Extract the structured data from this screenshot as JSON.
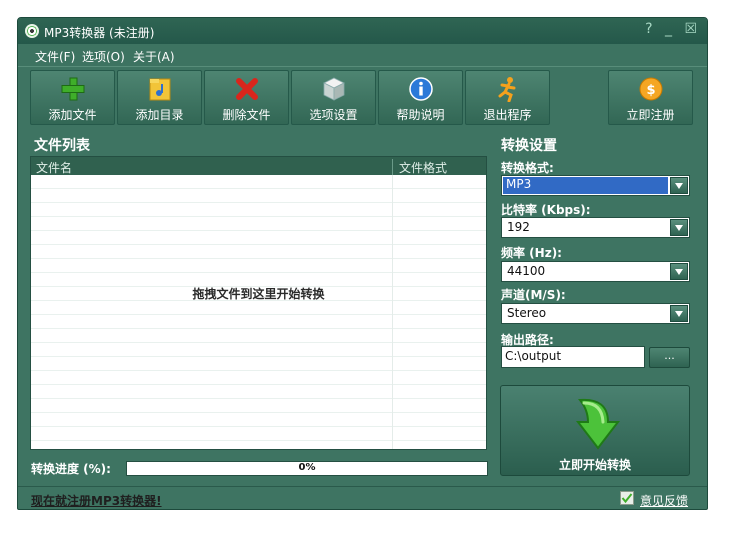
{
  "window": {
    "title": "MP3转换器 (未注册)",
    "controls": {
      "help": "?",
      "minimize": "_",
      "close": "☒"
    }
  },
  "menu": {
    "file": "文件(F)",
    "options": "选项(O)",
    "about": "关于(A)"
  },
  "toolbar": {
    "add_file": "添加文件",
    "add_dir": "添加目录",
    "delete_file": "删除文件",
    "settings": "选项设置",
    "help": "帮助说明",
    "exit": "退出程序",
    "register": "立即注册"
  },
  "file_list": {
    "title": "文件列表",
    "columns": [
      "文件名",
      "文件格式"
    ],
    "drop_hint": "拖拽文件到这里开始转换"
  },
  "progress": {
    "label": "转换进度 (%):",
    "value_text": "0%",
    "value": 0
  },
  "settings": {
    "title": "转换设置",
    "format_label": "转换格式:",
    "format_value": "MP3",
    "bitrate_label": "比特率 (Kbps):",
    "bitrate_value": "192",
    "freq_label": "频率 (Hz):",
    "freq_value": "44100",
    "channel_label": "声道(M/S):",
    "channel_value": "Stereo",
    "output_label": "输出路径:",
    "output_value": "C:\\output",
    "browse_label": "...",
    "start_label": "立即开始转换"
  },
  "status": {
    "register_link": "现在就注册MP3转换器!",
    "feedback": "意见反馈"
  },
  "colors": {
    "window_bg": "#3e7462",
    "title_bg": "#2f6553",
    "selection": "#316ac5"
  }
}
